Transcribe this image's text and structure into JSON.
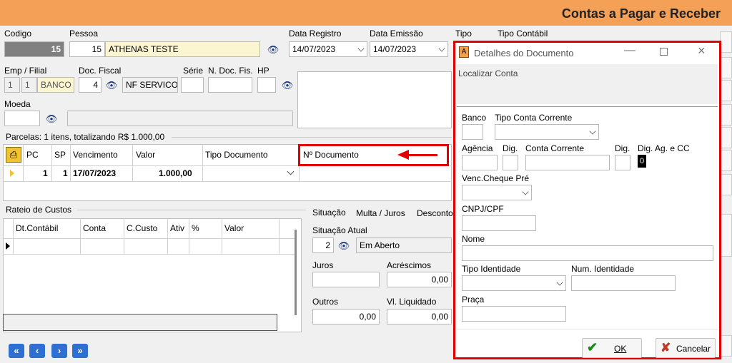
{
  "app": {
    "title": "Contas a Pagar e Receber"
  },
  "header": {
    "codigo_label": "Codigo",
    "codigo_value": "15",
    "pessoa_label": "Pessoa",
    "pessoa_id": "15",
    "pessoa_name": "ATHENAS TESTE",
    "data_registro_label": "Data Registro",
    "data_registro_value": "14/07/2023",
    "data_emissao_label": "Data Emissão",
    "data_emissao_value": "14/07/2023",
    "tipo_label": "Tipo",
    "tipo_contabil_label": "Tipo Contábil",
    "emp_filial_label": "Emp / Filial",
    "emp": "1",
    "filial": "1",
    "banco": "BANCO I",
    "doc_fiscal_label": "Doc. Fiscal",
    "doc_fiscal_value": "4",
    "doc_fiscal_desc": "NF SERVICO",
    "serie_label": "Série",
    "n_doc_fis_label": "N. Doc. Fis.",
    "hp_label": "HP",
    "moeda_label": "Moeda"
  },
  "parcelas": {
    "summary": "Parcelas: 1 itens, totalizando R$ 1.000,00",
    "columns": [
      "PC",
      "SP",
      "Vencimento",
      "Valor",
      "Tipo Documento",
      "Nº Documento"
    ],
    "rows": [
      {
        "pc": "1",
        "sp": "1",
        "vencimento": "17/07/2023",
        "valor": "1.000,00",
        "tipo_documento": "",
        "n_documento": ""
      }
    ]
  },
  "rateio": {
    "title": "Rateio de Custos",
    "columns": [
      "Dt.Contábil",
      "Conta",
      "C.Custo",
      "Ativ",
      "%",
      "Valor"
    ]
  },
  "situacao": {
    "tabs": [
      "Situação",
      "Multa / Juros",
      "Desconto"
    ],
    "situacao_atual_label": "Situação Atual",
    "situacao_code": "2",
    "situacao_desc": "Em Aberto",
    "juros_label": "Juros",
    "acrescimos_label": "Acréscimos",
    "acrescimos_value": "0,00",
    "outros_label": "Outros",
    "outros_value": "0,00",
    "vl_liquidado_label": "Vl. Liquidado",
    "vl_liquidado_value": "0,00"
  },
  "nav": {
    "first": "«",
    "prev": "‹",
    "next": "›",
    "last": "»"
  },
  "dialog": {
    "title": "Detalhes do Documento",
    "localizar": "Localizar Conta",
    "banco_label": "Banco",
    "tipo_conta_label": "Tipo Conta Corrente",
    "agencia_label": "Agência",
    "dig_label": "Dig.",
    "conta_corrente_label": "Conta Corrente",
    "dig2_label": "Dig.",
    "dig_ag_cc_label": "Dig. Ag. e CC",
    "dig_ag_cc_value": "0",
    "venc_cheque_label": "Venc.Cheque Pré",
    "cnpj_label": "CNPJ/CPF",
    "nome_label": "Nome",
    "tipo_identidade_label": "Tipo Identidade",
    "num_identidade_label": "Num. Identidade",
    "praca_label": "Praça",
    "ok_label": "OK",
    "cancelar_label": "Cancelar"
  },
  "colors": {
    "title_bar": "#f5a057",
    "highlight": "#e00000",
    "nav_button": "#2f6fd1"
  }
}
